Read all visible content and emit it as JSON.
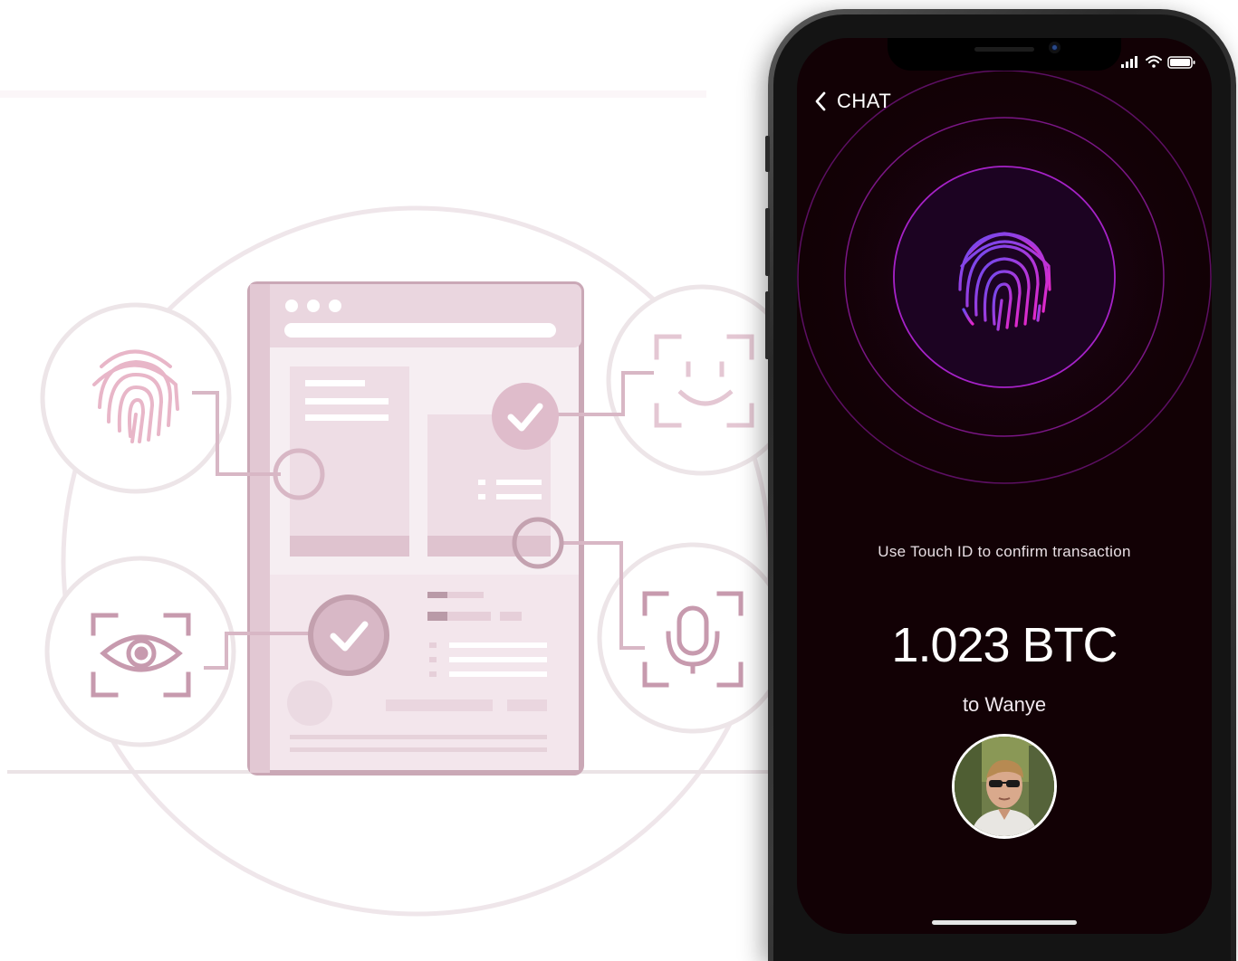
{
  "nav": {
    "back_label": "CHAT"
  },
  "confirm": {
    "prompt": "Use Touch ID to confirm transaction",
    "amount": "1.023 BTC",
    "recipient": "to Wanye"
  },
  "icons": {
    "status": [
      "cellular-signal-icon",
      "wifi-icon",
      "battery-icon"
    ],
    "main": "fingerprint-icon",
    "back": "chevron-left-icon"
  },
  "colors": {
    "screen_bg": "#120105",
    "ring_accent": "#a622c8",
    "fingerprint_gradient": [
      "#6a4cf0",
      "#e327c9"
    ],
    "illustration_pink": "#c79aae"
  }
}
